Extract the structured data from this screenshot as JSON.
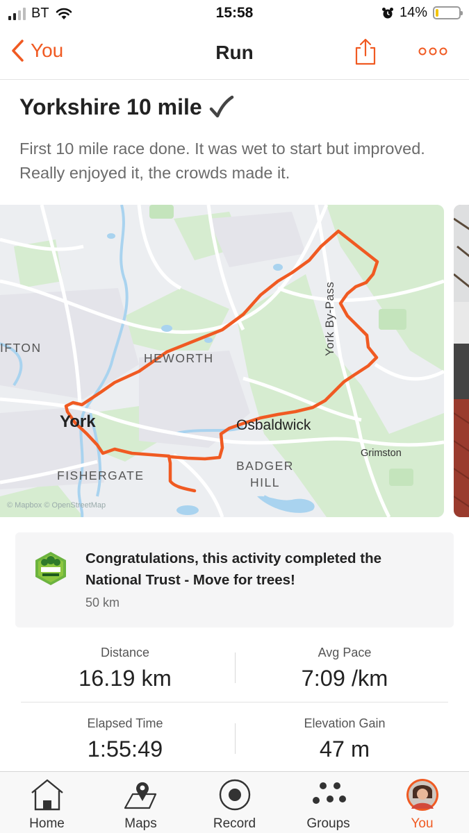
{
  "status_bar": {
    "carrier": "BT",
    "time": "15:58",
    "battery_percent": "14%",
    "battery_level": 0.14,
    "signal_bars": 2,
    "icons": [
      "cellular-signal-icon",
      "wifi-icon",
      "alarm-icon",
      "battery-icon"
    ]
  },
  "nav": {
    "back_label": "You",
    "title": "Run",
    "accent_color": "#f05a22"
  },
  "activity": {
    "title": "Yorkshire 10 mile",
    "title_emoji": "check-mark",
    "description": "First 10 mile race done. It was wet to start but improved. Really enjoyed it, the crowds made it."
  },
  "map": {
    "labels": {
      "clifton": "IFTON",
      "heworth": "HEWORTH",
      "york": "York",
      "osbaldwick": "Osbaldwick",
      "fishergate": "FISHERGATE",
      "badger_hill_1": "BADGER",
      "badger_hill_2": "HILL",
      "grimston": "Grimston",
      "bypass": "York By-Pass"
    },
    "attribution": "© Mapbox © OpenStreetMap",
    "route_color": "#f05a22"
  },
  "achievement": {
    "text": "Congratulations, this activity completed the National Trust - Move for trees!",
    "distance": "50 km",
    "badge_icon": "move-for-trees-badge"
  },
  "stats": [
    {
      "label": "Distance",
      "value": "16.19 km"
    },
    {
      "label": "Avg Pace",
      "value": "7:09 /km"
    },
    {
      "label": "Elapsed Time",
      "value": "1:55:49"
    },
    {
      "label": "Elevation Gain",
      "value": "47 m"
    }
  ],
  "tabs": [
    {
      "label": "Home",
      "icon": "home-icon"
    },
    {
      "label": "Maps",
      "icon": "map-pin-icon"
    },
    {
      "label": "Record",
      "icon": "record-icon"
    },
    {
      "label": "Groups",
      "icon": "groups-icon"
    },
    {
      "label": "You",
      "icon": "avatar",
      "active": true
    }
  ]
}
